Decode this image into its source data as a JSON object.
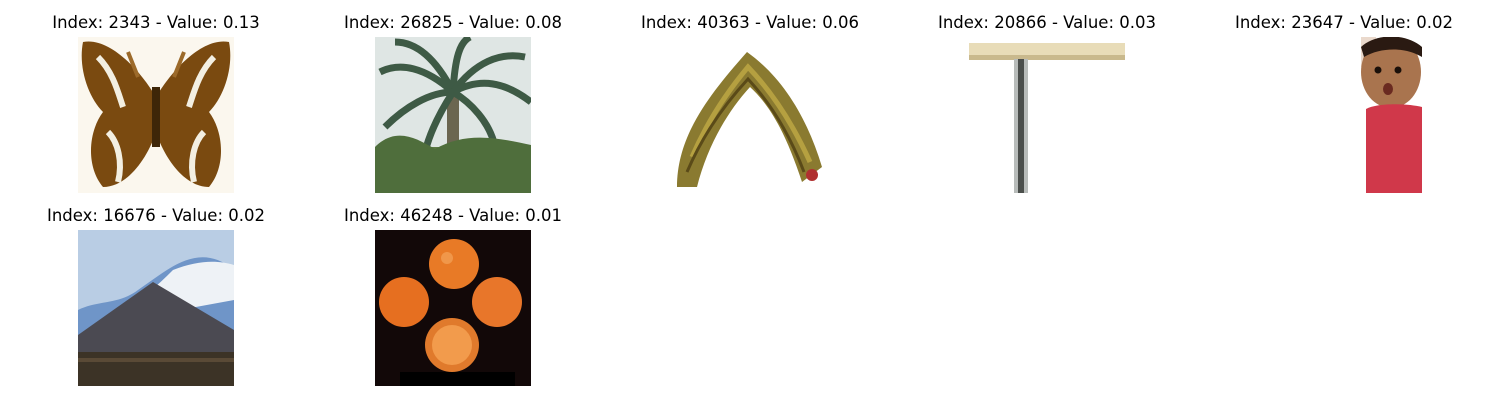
{
  "grid": {
    "items": [
      {
        "index": "2343",
        "value": "0.13",
        "title": "Index: 2343 - Value: 0.13",
        "subject": "butterfly"
      },
      {
        "index": "26825",
        "value": "0.08",
        "title": "Index: 26825 - Value: 0.08",
        "subject": "palm tree"
      },
      {
        "index": "40363",
        "value": "0.06",
        "title": "Index: 40363 - Value: 0.06",
        "subject": "caterpillar"
      },
      {
        "index": "20866",
        "value": "0.03",
        "title": "Index: 20866 - Value: 0.03",
        "subject": "table"
      },
      {
        "index": "23647",
        "value": "0.02",
        "title": "Index: 23647 - Value: 0.02",
        "subject": "boy"
      },
      {
        "index": "16676",
        "value": "0.02",
        "title": "Index: 16676 - Value: 0.02",
        "subject": "mountain"
      },
      {
        "index": "46248",
        "value": "0.01",
        "title": "Index: 46248 - Value: 0.01",
        "subject": "oranges"
      }
    ]
  }
}
